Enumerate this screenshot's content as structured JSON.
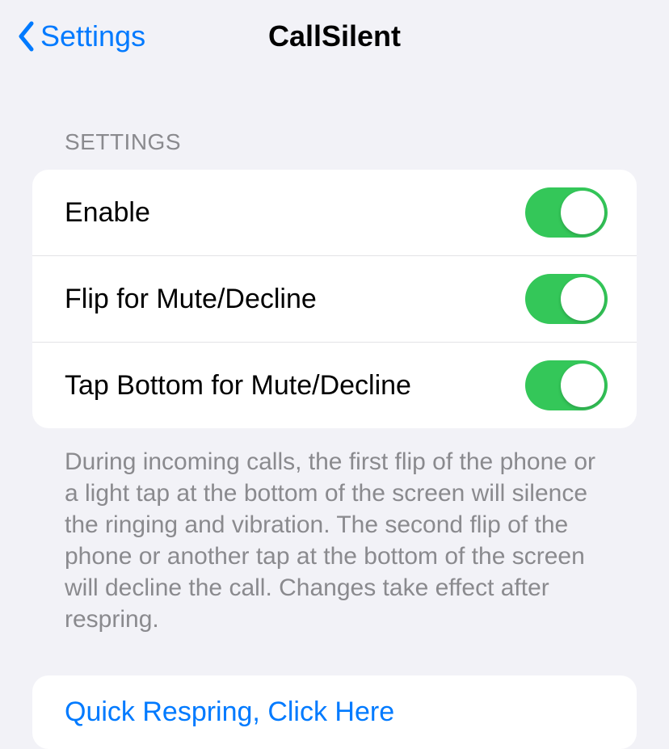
{
  "nav": {
    "back_label": "Settings",
    "title": "CallSilent"
  },
  "section_header": "SETTINGS",
  "settings": [
    {
      "label": "Enable",
      "enabled": true
    },
    {
      "label": "Flip for Mute/Decline",
      "enabled": true
    },
    {
      "label": "Tap Bottom for Mute/Decline",
      "enabled": true
    }
  ],
  "footer_text": "During incoming calls, the first flip of the phone or a light tap at the bottom of the screen will silence the ringing and vibration. The second flip of the phone or another tap at the bottom of the screen will decline the call. Changes take effect after respring.",
  "action": {
    "respring_label": "Quick Respring, Click Here"
  },
  "colors": {
    "accent": "#007aff",
    "toggle_on": "#34c759",
    "background": "#f2f2f7",
    "secondary_text": "#8a8a8e"
  }
}
